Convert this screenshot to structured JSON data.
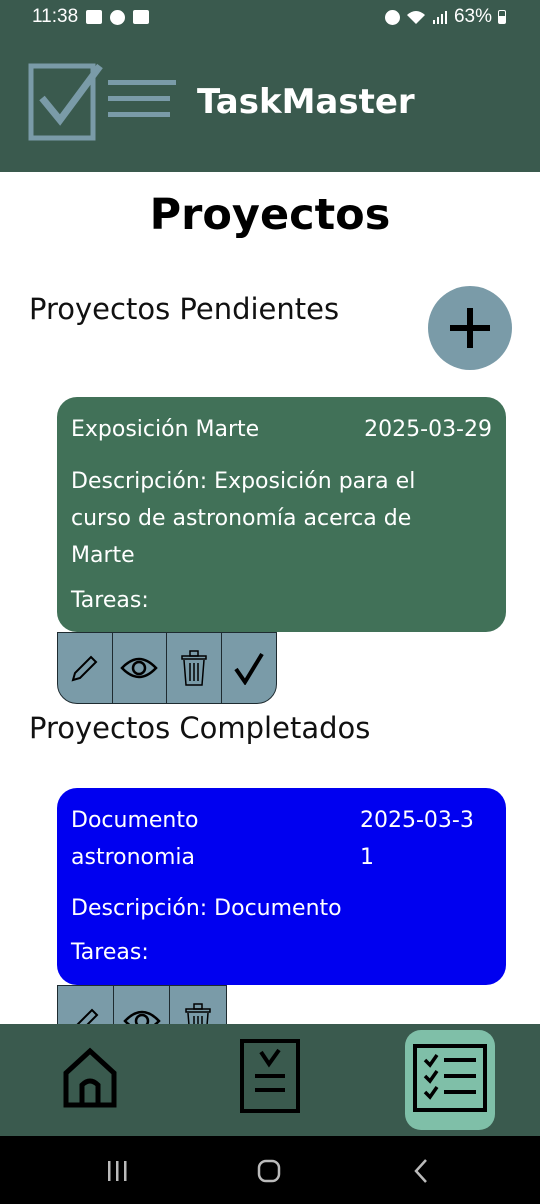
{
  "status_bar": {
    "time": "11:38",
    "battery": "63%"
  },
  "header": {
    "title": "TaskMaster"
  },
  "page": {
    "title": "Proyectos"
  },
  "pending": {
    "title": "Proyectos Pendientes",
    "projects": [
      {
        "name": "Exposición Marte",
        "date": "2025-03-29",
        "description": "Descripción: Exposición para el curso de astronomía acerca de Marte",
        "tasks": "Tareas:"
      }
    ]
  },
  "completed": {
    "title": "Proyectos Completados",
    "projects": [
      {
        "name": "Documento astronomia",
        "date": "2025-03-31",
        "description": "Descripción: Documento",
        "tasks": "Tareas:"
      }
    ]
  },
  "colors": {
    "header": "#3a5a4e",
    "pending_card": "#417158",
    "completed_card": "#0000f0",
    "accent": "#7a9ba8",
    "nav_active": "#7fbfa8"
  },
  "icons": [
    "checklist-logo-icon",
    "plus-icon",
    "pencil-icon",
    "eye-icon",
    "trash-icon",
    "checkmark-icon",
    "home-icon",
    "clipboard-check-icon",
    "checklist-icon"
  ]
}
